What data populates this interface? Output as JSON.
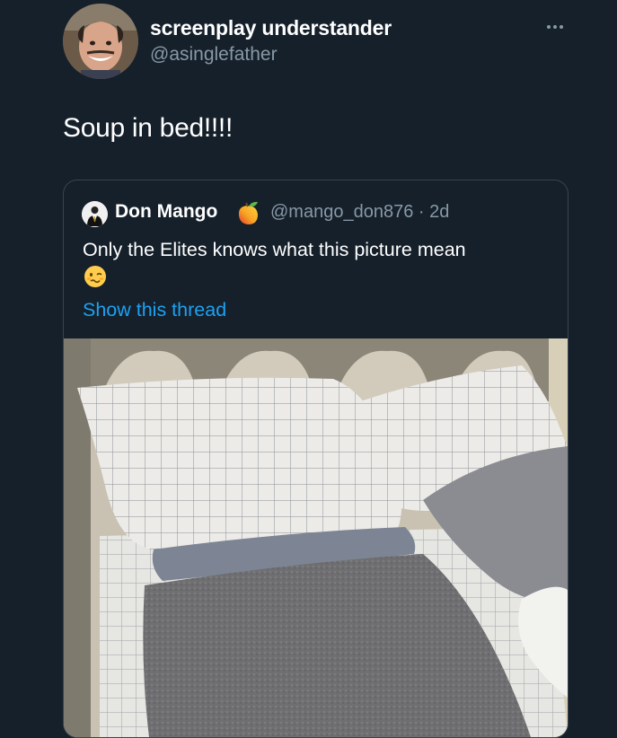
{
  "tweet": {
    "author_name": "screenplay understander",
    "author_handle": "@asinglefather",
    "text": "Soup in bed!!!!"
  },
  "quoted_tweet": {
    "author_name": "Don Mango",
    "author_handle_time": "@mango_don876 · 2d",
    "text": "Only the Elites knows what this picture mean",
    "show_thread": "Show this thread"
  },
  "colors": {
    "background": "#15202b",
    "link": "#1da1f2",
    "secondary_text": "#8899a6",
    "border": "#38444d"
  },
  "icons": {
    "more": "more-horizontal-icon",
    "author_emoji": "mango-emoji-icon",
    "inline_emoji": "woozy-face-emoji-icon"
  }
}
